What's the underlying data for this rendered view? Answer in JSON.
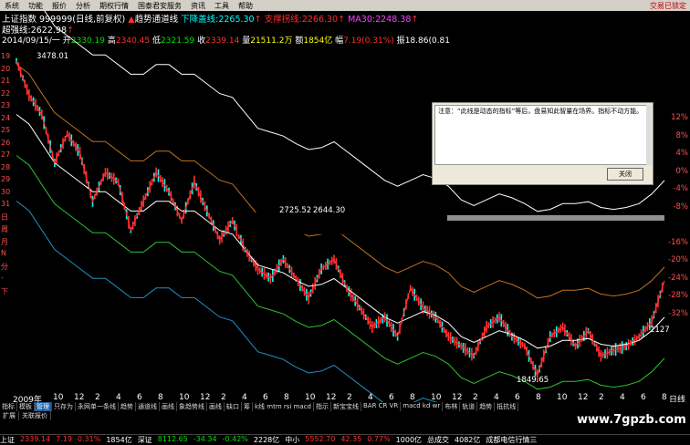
{
  "menu": {
    "items": [
      "系统",
      "功能",
      "报价",
      "分析",
      "期权行情",
      "国泰君安服务",
      "资讯",
      "工具",
      "帮助"
    ],
    "status": "交易已锁定"
  },
  "header": {
    "title": "上证指数 999999(日线,前复权)",
    "trend_label": "趋势通道线",
    "down_line_label": "下降盖线:",
    "down_line_value": "2265.30",
    "support_label": "支撑拐线:",
    "support_value": "2266.30",
    "ma30_label": "MA30:",
    "ma30_value": "2248.38",
    "strong_label": "超强线:",
    "strong_value": "2622.98",
    "date": "2014/09/15/一",
    "open_label": "开",
    "open_value": "2330.19",
    "high_label": "高",
    "high_value": "2340.45",
    "low_label": "低",
    "low_value": "2321.59",
    "close_label": "收",
    "close_value": "2339.14",
    "volume_label": "量",
    "volume_value": "21511.2万",
    "amount_label": "额",
    "amount_value": "1854亿",
    "change_label": "幅",
    "change_value": "7.19(0.31%)",
    "amp_label": "振",
    "amp_value": "18.86(0.81"
  },
  "annotations": {
    "high": "3478.01",
    "mid": "2725.52",
    "mid2": "2644.30",
    "low": "1849.65",
    "right": "2127"
  },
  "yaxis_right": [
    "12%",
    "8%",
    "4%",
    "0%",
    "-4%",
    "-8%",
    "-12%",
    "-16%",
    "-20%",
    "-24%",
    "-28%",
    "-32%"
  ],
  "yaxis_left": [
    "19",
    "20",
    "21",
    "22",
    "23",
    "24",
    "25",
    "26",
    "27",
    "28",
    "29",
    "30",
    "31",
    "日",
    "周",
    "月",
    "N",
    "分",
    "-",
    "下"
  ],
  "xaxis": {
    "labels": [
      "2009年",
      "10",
      "12",
      "2",
      "4",
      "6",
      "8",
      "10",
      "12",
      "2",
      "4",
      "6",
      "8",
      "10",
      "12",
      "2",
      "4",
      "6",
      "8",
      "10",
      "12",
      "2",
      "4",
      "6",
      "8",
      "10",
      "12",
      "2",
      "4",
      "6",
      "8"
    ],
    "right_label": "日线"
  },
  "dialog": {
    "message": "注意：“此线是动态的指标”等后，盘易知此智量在场界。指标不动方能。",
    "button": "关闭"
  },
  "tabs": [
    "指标",
    "模板",
    "管理",
    "只存为",
    "永网单一条线",
    "趋势",
    "通道线",
    "画线",
    "象趋势线",
    "画线",
    "缺口",
    "筹",
    "k线 mtm rsi macd",
    "指示",
    "新宝宝线",
    "BAR CR VR",
    "macd kd wr",
    "布林",
    "轨道",
    "趋势",
    "抵抗线"
  ],
  "tabs2": [
    "扩展",
    "关联报价"
  ],
  "footer": {
    "sh_label": "上证",
    "sh_value": "2339.14",
    "sh_change": "7.19",
    "sh_pct": "0.31%",
    "sh_amount": "1854亿",
    "sz_label": "深证",
    "sz_value": "8112.65",
    "sz_change": "-34.34",
    "sz_pct": "-0.42%",
    "sz_amount": "2228亿",
    "zx_label": "中小",
    "zx_value": "5552.70",
    "zx_change": "42.35",
    "zx_pct": "0.77%",
    "zx_amount": "1000亿",
    "total_label": "总成交",
    "total_value": "4082亿",
    "site": "成都电信行情三"
  },
  "watermark": "www.7gpzb.com",
  "colors": {
    "bg": "#000000",
    "up": "#ff3030",
    "down": "#00ffff",
    "ma_white": "#ffffff",
    "band_orange": "#c07020",
    "band_green": "#30c030",
    "band_blue": "#2090c0"
  },
  "chart_data": {
    "type": "line",
    "series": [
      {
        "values": [
          3478,
          3300,
          3200,
          2950,
          3100,
          3000,
          2750,
          2900,
          2850,
          2600,
          2750,
          2900,
          2800,
          2650,
          2850,
          2700,
          2550,
          2650,
          2500,
          2400,
          2350,
          2450,
          2350,
          2250,
          2400,
          2450,
          2300,
          2200,
          2100,
          2150,
          2050,
          2300,
          2200,
          2150,
          2050,
          2000,
          1950,
          2100,
          2150,
          2050,
          2000,
          1849,
          2050,
          2100,
          2000,
          2080,
          1950,
          1980,
          2000,
          2050,
          2127,
          2339
        ]
      },
      {
        "values": [
          3200,
          3150,
          3050,
          2950,
          2900,
          2850,
          2800,
          2800,
          2750,
          2700,
          2700,
          2750,
          2750,
          2700,
          2700,
          2650,
          2600,
          2580,
          2500,
          2420,
          2400,
          2380,
          2340,
          2310,
          2320,
          2350,
          2300,
          2250,
          2200,
          2150,
          2120,
          2150,
          2180,
          2160,
          2120,
          2050,
          2020,
          2050,
          2080,
          2060,
          2030,
          1990,
          2000,
          2030,
          2030,
          2040,
          2010,
          2000,
          2010,
          2030,
          2080,
          2150
        ]
      }
    ]
  }
}
